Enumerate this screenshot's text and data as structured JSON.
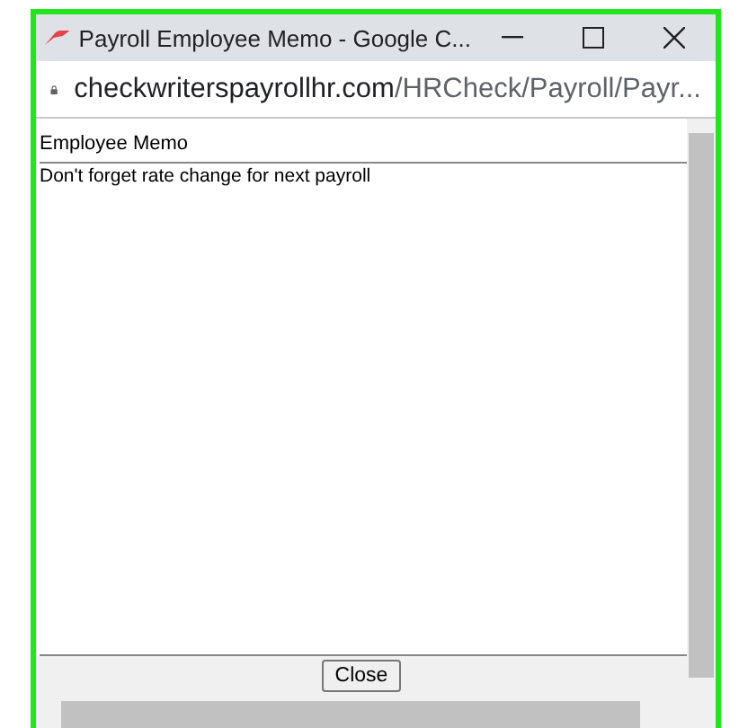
{
  "window": {
    "title": "Payroll Employee Memo - Google C..."
  },
  "address_bar": {
    "domain": "checkwriterspayrollhr.com",
    "path": "/HRCheck/Payroll/Payr..."
  },
  "memo": {
    "heading": "Employee Memo",
    "value": "Don't forget rate change for next payroll"
  },
  "buttons": [
    "Close"
  ]
}
